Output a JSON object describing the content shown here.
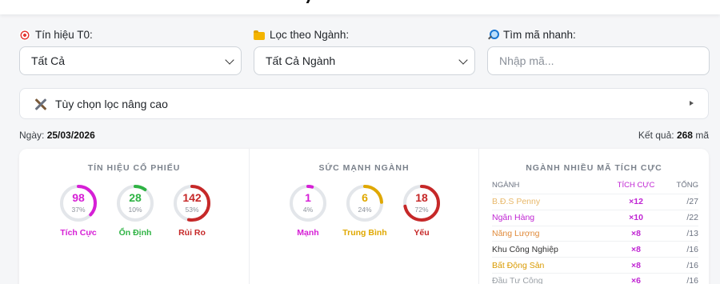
{
  "filters": {
    "signal": {
      "label": "Tín hiệu T0:",
      "icon": "target-icon",
      "value": "Tất Cả"
    },
    "sector": {
      "label": "Lọc theo Ngành:",
      "icon": "folder-icon",
      "value": "Tất Cả Ngành"
    },
    "search": {
      "label": "Tìm mã nhanh:",
      "icon": "search-icon",
      "placeholder": "Nhập mã..."
    }
  },
  "advanced": {
    "label": "Tùy chọn lọc nâng cao",
    "icon": "tools-icon"
  },
  "meta": {
    "date_label": "Ngày:",
    "date": "25/03/2026",
    "result_label": "Kết quả:",
    "result_count": "268",
    "result_unit": "mã"
  },
  "stock_signals": {
    "title": "TÍN HIỆU CỔ PHIẾU",
    "gauges": [
      {
        "value": "98",
        "percent": "37%",
        "fraction": 0.37,
        "label": "Tích Cực",
        "color": "#d61fd6"
      },
      {
        "value": "28",
        "percent": "10%",
        "fraction": 0.1,
        "label": "Ổn Định",
        "color": "#2fb344"
      },
      {
        "value": "142",
        "percent": "53%",
        "fraction": 0.53,
        "label": "Rủi Ro",
        "color": "#c62828"
      }
    ]
  },
  "sector_strength": {
    "title": "SỨC MẠNH NGÀNH",
    "gauges": [
      {
        "value": "1",
        "percent": "4%",
        "fraction": 0.04,
        "label": "Mạnh",
        "color": "#d61fd6"
      },
      {
        "value": "6",
        "percent": "24%",
        "fraction": 0.24,
        "label": "Trung Bình",
        "color": "#e0a800"
      },
      {
        "value": "18",
        "percent": "72%",
        "fraction": 0.72,
        "label": "Yếu",
        "color": "#c62828"
      }
    ]
  },
  "top_sectors": {
    "title": "NGÀNH NHIỀU MÃ TÍCH CỰC",
    "headers": {
      "sector": "NGÀNH",
      "positive": "TÍCH CỰC",
      "total": "TỔNG"
    },
    "rows": [
      {
        "name": "B.Đ.S Penny",
        "positive": "×12",
        "total": "/27",
        "color": "#e8b86a"
      },
      {
        "name": "Ngân Hàng",
        "positive": "×10",
        "total": "/22",
        "color": "#c026d3"
      },
      {
        "name": "Năng Lượng",
        "positive": "×8",
        "total": "/13",
        "color": "#e08a3a"
      },
      {
        "name": "Khu Công Nghiệp",
        "positive": "×8",
        "total": "/16",
        "color": "#333333"
      },
      {
        "name": "Bất Động Sản",
        "positive": "×8",
        "total": "/16",
        "color": "#d99a00"
      },
      {
        "name": "Đầu Tư Công",
        "positive": "×6",
        "total": "/16",
        "color": "#9aa0a6"
      }
    ]
  },
  "colors": {
    "accent": "#c026d3",
    "positive": "#d61fd6",
    "stable": "#2fb344",
    "risk": "#c62828",
    "track": "#e3e6ea"
  }
}
